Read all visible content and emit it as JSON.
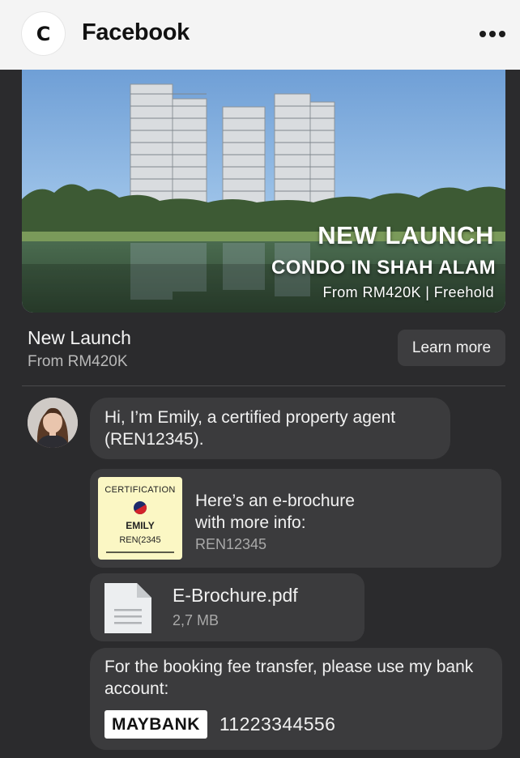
{
  "header": {
    "app_logo_glyph": "C",
    "app_title": "Facebook",
    "more_icon": "more-dots-icon"
  },
  "ad": {
    "image_headline": "NEW LAUNCH",
    "image_subheadline": "CONDO IN SHAH ALAM",
    "image_price_line": "From RM420K | Freehold",
    "title": "New Launch",
    "subtitle": "From RM420K",
    "cta_label": "Learn more"
  },
  "chat": {
    "intro_message": "Hi, I’m Emily, a certified property agent (REN12345).",
    "certificate": {
      "title": "CERTIFICATION",
      "name": "EMILY",
      "id_text": "REN(2345"
    },
    "brochure_message": "Here’s an e-brochure with more info:",
    "brochure_ref": "REN12345",
    "file": {
      "name": "E-Brochure.pdf",
      "size": "2,7 MB",
      "icon": "document-icon"
    },
    "bank_message": "For the booking fee transfer, please use my bank account:",
    "bank_name": "MAYBANK",
    "bank_account": "11223344556"
  },
  "colors": {
    "background": "#2b2b2d",
    "bubble": "#3b3b3d",
    "topbar": "#f4f4f4"
  }
}
